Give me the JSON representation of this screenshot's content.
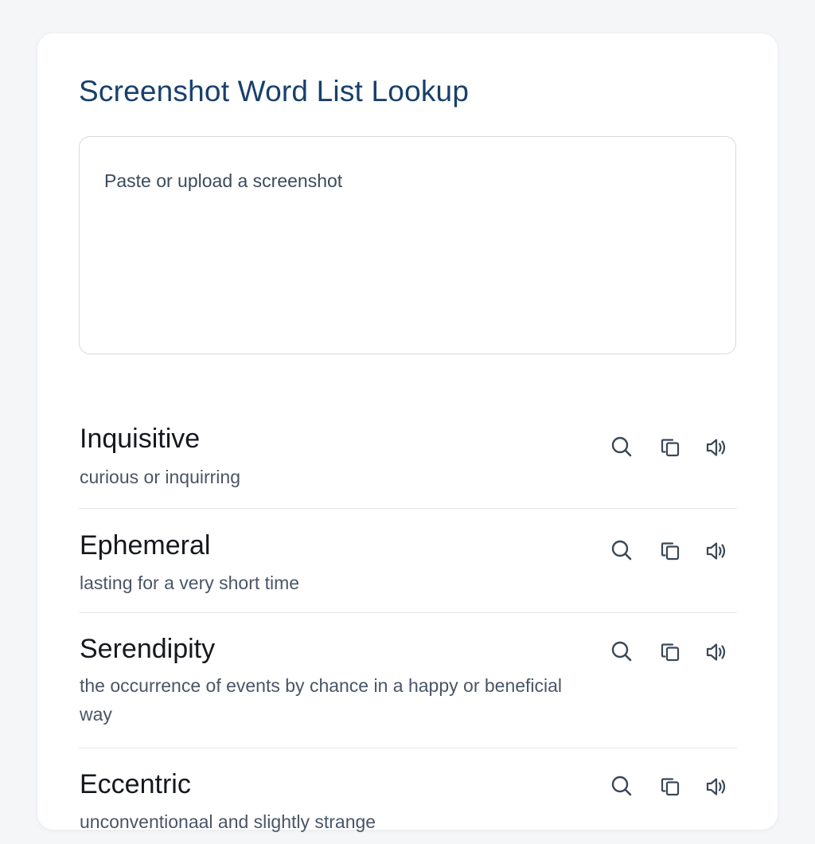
{
  "app": {
    "title": "Screenshot Word List Lookup"
  },
  "dropzone": {
    "placeholder": "Paste or upload a screenshot"
  },
  "words": [
    {
      "word": "Inquisitive",
      "definition": "curious or inquirring"
    },
    {
      "word": "Ephemeral",
      "definition": "lasting for a very short time"
    },
    {
      "word": "Serendipity",
      "definition": "the occurrence of events by chance in a happy or beneficial way"
    },
    {
      "word": "Eccentric",
      "definition": "unconventionaal and slightly strange"
    }
  ],
  "icons": {
    "search": "search-icon",
    "copy": "copy-icon",
    "speak": "speaker-icon"
  },
  "colors": {
    "title": "#18406b",
    "word": "#15181d",
    "definition": "#4a5566",
    "icon": "#3a4757",
    "divider": "#e5e7eb",
    "border": "#d5d9df"
  }
}
